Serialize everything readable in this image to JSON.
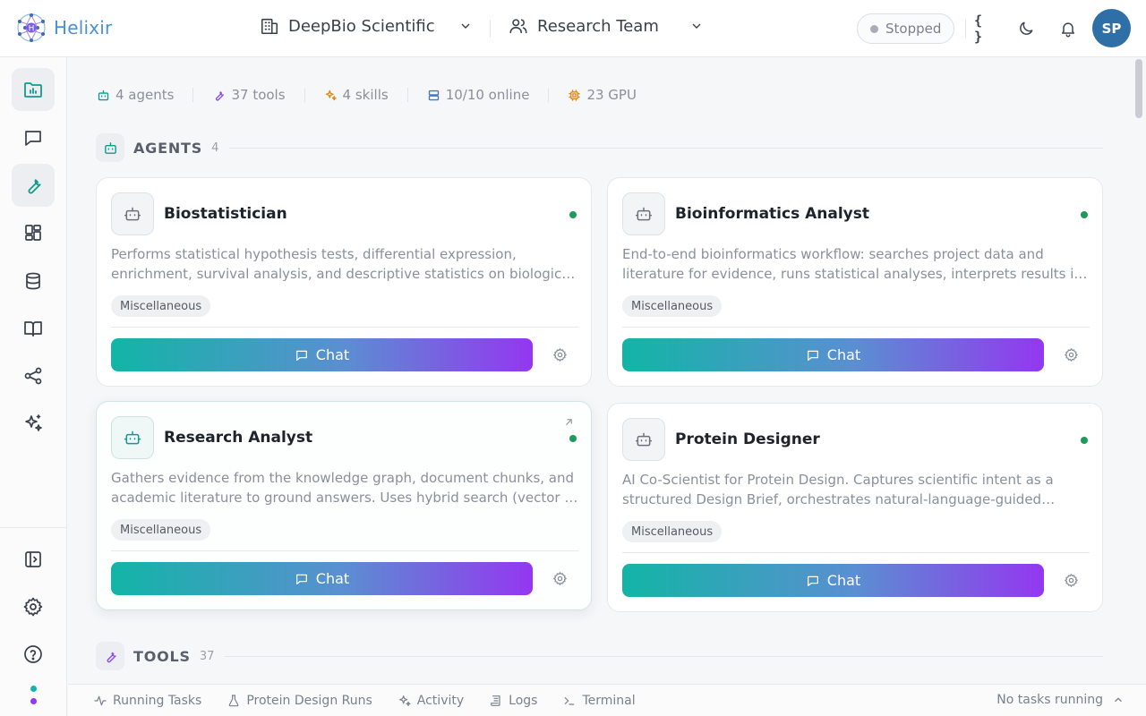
{
  "header": {
    "app_name": "Helixir",
    "org": "DeepBio Scientific",
    "team": "Research Team",
    "status": "Stopped",
    "avatar_initials": "SP"
  },
  "sidebar": {
    "items": [
      {
        "name": "projects",
        "icon": "folder-chart-icon",
        "active": true
      },
      {
        "name": "chat",
        "icon": "chat-bubble-icon",
        "active": false
      },
      {
        "name": "tools",
        "icon": "wrench-icon",
        "active": true
      },
      {
        "name": "dashboard",
        "icon": "grid-icon",
        "active": false
      },
      {
        "name": "database",
        "icon": "database-icon",
        "active": false
      },
      {
        "name": "library",
        "icon": "book-open-icon",
        "active": false
      },
      {
        "name": "graph",
        "icon": "share-graph-icon",
        "active": false
      },
      {
        "name": "skills",
        "icon": "sparkles-icon",
        "active": false
      }
    ],
    "bottom": [
      "panel-toggle-icon",
      "gear-icon",
      "help-icon"
    ]
  },
  "stats": {
    "agents": "4 agents",
    "tools": "37 tools",
    "skills": "4 skills",
    "online": "10/10 online",
    "gpu": "23 GPU"
  },
  "agents_section": {
    "title": "AGENTS",
    "count": "4"
  },
  "tools_section": {
    "title": "TOOLS",
    "count": "37"
  },
  "agents": [
    {
      "name": "Biostatistician",
      "description": "Performs statistical hypothesis tests, differential expression, enrichment, survival analysis, and descriptive statistics on biological datasets.",
      "tag": "Miscellaneous",
      "chat_label": "Chat"
    },
    {
      "name": "Bioinformatics Analyst",
      "description": "End-to-end bioinformatics workflow: searches project data and literature for evidence, runs statistical analyses, interprets results in context.",
      "tag": "Miscellaneous",
      "chat_label": "Chat"
    },
    {
      "name": "Research Analyst",
      "description": "Gathers evidence from the knowledge graph, document chunks, and academic literature to ground answers. Uses hybrid search (vector + keyword).",
      "tag": "Miscellaneous",
      "chat_label": "Chat"
    },
    {
      "name": "Protein Designer",
      "description": "AI Co-Scientist for Protein Design. Captures scientific intent as a structured Design Brief, orchestrates natural-language-guided design runs.",
      "tag": "Miscellaneous",
      "chat_label": "Chat"
    }
  ],
  "bottombar": {
    "running_tasks": "Running Tasks",
    "protein_runs": "Protein Design Runs",
    "activity": "Activity",
    "logs": "Logs",
    "terminal": "Terminal",
    "status": "No tasks running"
  },
  "colors": {
    "accent_teal": "#12b5a6",
    "accent_purple": "#9437f0",
    "online_green": "#1e9a5a",
    "brand_blue": "#4a90d9"
  }
}
